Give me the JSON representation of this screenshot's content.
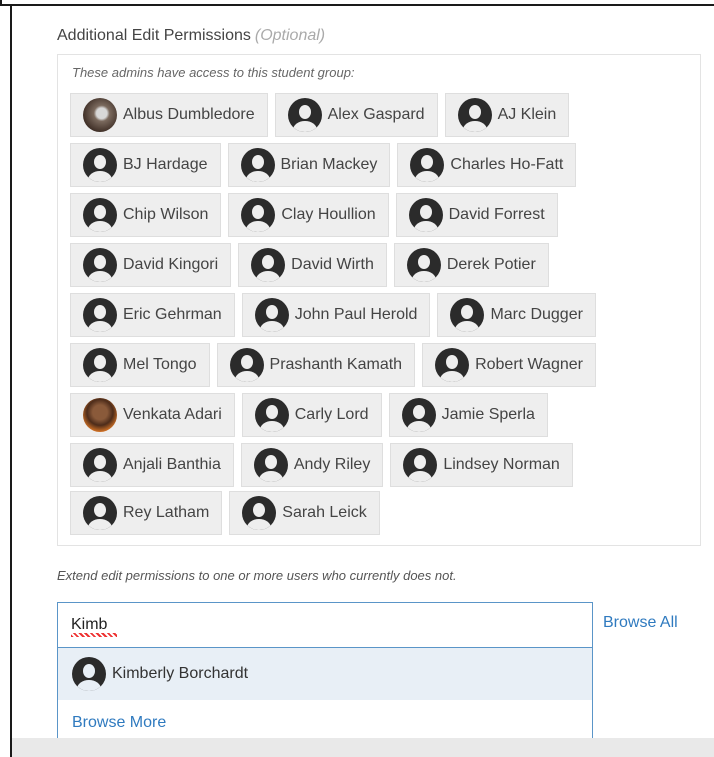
{
  "section": {
    "label": "Additional Edit Permissions",
    "optional_tag": "(Optional)"
  },
  "group": {
    "description": "These admins have access to this student group:",
    "admins": [
      {
        "name": "Albus Dumbledore",
        "avatar": "photo"
      },
      {
        "name": "Alex Gaspard",
        "avatar": "default"
      },
      {
        "name": "AJ Klein",
        "avatar": "default"
      },
      {
        "name": "BJ Hardage",
        "avatar": "default"
      },
      {
        "name": "Brian Mackey",
        "avatar": "default"
      },
      {
        "name": "Charles Ho-Fatt",
        "avatar": "default"
      },
      {
        "name": "Chip Wilson",
        "avatar": "default"
      },
      {
        "name": "Clay Houllion",
        "avatar": "default"
      },
      {
        "name": "David Forrest",
        "avatar": "default"
      },
      {
        "name": "David Kingori",
        "avatar": "default"
      },
      {
        "name": "David Wirth",
        "avatar": "default"
      },
      {
        "name": "Derek Potier",
        "avatar": "default"
      },
      {
        "name": "Eric Gehrman",
        "avatar": "default"
      },
      {
        "name": "John Paul Herold",
        "avatar": "default"
      },
      {
        "name": "Marc Dugger",
        "avatar": "default"
      },
      {
        "name": "Mel Tongo",
        "avatar": "default"
      },
      {
        "name": "Prashanth Kamath",
        "avatar": "default"
      },
      {
        "name": "Robert Wagner",
        "avatar": "default"
      },
      {
        "name": "Venkata Adari",
        "avatar": "photo"
      },
      {
        "name": "Carly Lord",
        "avatar": "default"
      },
      {
        "name": "Jamie Sperla",
        "avatar": "default"
      },
      {
        "name": "Anjali Banthia",
        "avatar": "default"
      },
      {
        "name": "Andy Riley",
        "avatar": "default"
      },
      {
        "name": "Lindsey Norman",
        "avatar": "default"
      },
      {
        "name": "Rey Latham",
        "avatar": "default"
      },
      {
        "name": "Sarah Leick",
        "avatar": "default"
      }
    ]
  },
  "extend": {
    "description": "Extend edit permissions to one or more users who currently does not."
  },
  "search": {
    "value": "Kimb",
    "browse_all_label": "Browse All"
  },
  "dropdown": {
    "suggestion": "Kimberly Borchardt",
    "browse_more_label": "Browse More"
  },
  "colors": {
    "link": "#2f7abf",
    "chip_bg": "#eeeeee",
    "input_border": "#5a95c8",
    "suggestion_highlight": "#e8eff6"
  },
  "icons": {
    "default_avatar": "user-silhouette-icon"
  }
}
